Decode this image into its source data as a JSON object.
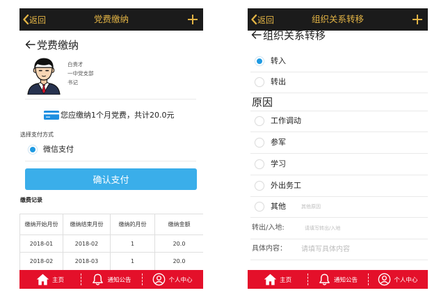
{
  "theme": {
    "topbar_bg": "#1b1b1b",
    "topbar_accent": "#e3b445",
    "primary_blue": "#3aaeea",
    "radio_blue": "#1f9ae2",
    "nav_red": "#e4102a",
    "card_blue": "#1f8fe0"
  },
  "payment_screen": {
    "topbar": {
      "back_icon": "chevron-left-icon",
      "back_label": "返回",
      "title": "党费缴纳",
      "add_icon": "plus-icon"
    },
    "heading": {
      "icon": "arrow-left-icon",
      "label": "党费缴纳"
    },
    "profile": {
      "avatar_icon": "avatar-icon",
      "name": "白贵才",
      "branch": "一中党支部",
      "position": "书记"
    },
    "due_notice": {
      "icon": "credit-card-icon",
      "text": "您应缴纳1个月党费，共计20.0元"
    },
    "payment_method": {
      "label": "选择支付方式",
      "options": [
        {
          "label": "微信支付",
          "selected": true
        }
      ]
    },
    "confirm_button": "确认支付",
    "records": {
      "title": "缴费记录",
      "columns": [
        "缴纳开始月份",
        "缴纳结束月份",
        "缴纳的月份",
        "缴纳金额"
      ],
      "rows": [
        [
          "2018-01",
          "2018-02",
          "1",
          "20.0"
        ],
        [
          "2018-02",
          "2018-03",
          "1",
          "20.0"
        ]
      ]
    },
    "bottom_nav": [
      {
        "icon": "house-icon",
        "label": "主页"
      },
      {
        "icon": "bell-icon",
        "label": "通知公告"
      },
      {
        "icon": "user-circle-icon",
        "label": "个人中心"
      }
    ]
  },
  "transfer_screen": {
    "topbar": {
      "back_icon": "chevron-left-icon",
      "back_label": "返回",
      "title": "组织关系转移",
      "add_icon": "plus-icon"
    },
    "heading": {
      "icon": "arrow-left-icon",
      "label": "组织关系转移"
    },
    "direction_options": [
      {
        "label": "转入",
        "selected": true
      },
      {
        "label": "转出",
        "selected": false
      }
    ],
    "reason": {
      "heading": "原因",
      "options": [
        {
          "label": "工作调动",
          "selected": false
        },
        {
          "label": "参军",
          "selected": false
        },
        {
          "label": "学习",
          "selected": false
        },
        {
          "label": "外出务工",
          "selected": false
        },
        {
          "label": "其他",
          "selected": false
        }
      ],
      "other_placeholder": "其他原因"
    },
    "fields": [
      {
        "label": "转出/入地:",
        "placeholder": "请填写转出/入地"
      },
      {
        "label": "具体内容：",
        "placeholder": "请填写具体内容"
      }
    ],
    "bottom_nav": [
      {
        "icon": "house-icon",
        "label": "主页"
      },
      {
        "icon": "bell-icon",
        "label": "通知公告"
      },
      {
        "icon": "user-circle-icon",
        "label": "个人中心"
      }
    ]
  }
}
